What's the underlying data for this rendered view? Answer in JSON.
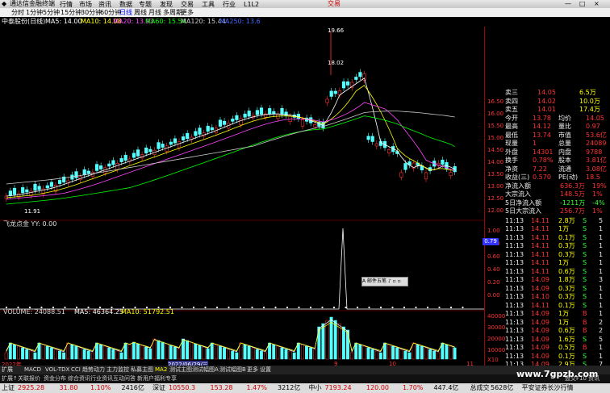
{
  "titlebar": {
    "app_title": "通达信金融终端",
    "right_label": "交易",
    "window_controls": [
      "—",
      "□",
      "×"
    ]
  },
  "menu": [
    "行情",
    "市场",
    "资讯",
    "数据",
    "专题",
    "发现",
    "交易",
    "工具",
    "行业",
    "L1L2"
  ],
  "periods": {
    "items": [
      "分时",
      "1分钟",
      "5分钟",
      "15分钟",
      "30分钟",
      "60分钟",
      "日线",
      "周线",
      "月线",
      "多周期",
      "更多"
    ],
    "active": "日线"
  },
  "infobar": {
    "stock": "中泰股份(日线)",
    "ma": [
      {
        "label": "MA5: 14.00",
        "color": "#ffffff"
      },
      {
        "label": "MA10: 14.08",
        "color": "#ffff00"
      },
      {
        "label": "MA20: 13.93",
        "color": "#ff44ff"
      },
      {
        "label": "MA60: 15.54",
        "color": "#00ff00"
      },
      {
        "label": "MA120: 15.44",
        "color": "#cccccc"
      },
      {
        "label": "MA250: 13.6",
        "color": "#4466ff"
      }
    ]
  },
  "price_axis": [
    "16.50",
    "16.00",
    "15.50",
    "15.00",
    "14.50",
    "14.00",
    "13.50",
    "13.00",
    "12.50",
    "12.00"
  ],
  "price_markers": {
    "high": "19.66",
    "mid": "18.02",
    "low": "11.91"
  },
  "indicator_panel": {
    "title": "飞龙点金  YY: 0.00",
    "axis": [
      "1.00",
      "0.80",
      "0.60",
      "0.40",
      "0.20",
      "0.00"
    ],
    "current": "0.79"
  },
  "volume_panel": {
    "title": "VOLUME: 24088.51",
    "ma5": "MA5: 46364.25",
    "ma10": "MA10: 51792.51",
    "axis": [
      "40000",
      "30000",
      "20000",
      "10000"
    ],
    "unit": "X10"
  },
  "date_labels": [
    "2022年",
    "2022/06/29/三",
    "9",
    "10",
    "11"
  ],
  "popup": {
    "label": "A 邮件五笔",
    "extra": "♪ ▫ ▫"
  },
  "quote": {
    "asks": [
      {
        "name": "卖三",
        "price": "14.05",
        "vol": "6.5万"
      },
      {
        "name": "卖四",
        "price": "14.02",
        "vol": "10.0万"
      },
      {
        "name": "卖五",
        "price": "14.01",
        "vol": "17.4万"
      }
    ],
    "stats": [
      [
        "今开",
        "13.78",
        "均价",
        "14.05"
      ],
      [
        "最高",
        "14.12",
        "量比",
        "0.97"
      ],
      [
        "最低",
        "13.74",
        "市值",
        "53.6亿"
      ],
      [
        "现量",
        "1",
        "总量",
        "24089"
      ],
      [
        "外盘",
        "14301",
        "内盘",
        "9788"
      ],
      [
        "换手",
        "0.78%",
        "股本",
        "3.81亿"
      ],
      [
        "净资",
        "7.22",
        "流通",
        "3.08亿"
      ],
      [
        "收益(三)",
        "0.570",
        "PE(动)",
        "18.5"
      ]
    ],
    "flows": [
      [
        "净流入额",
        "636.3万",
        "19%"
      ],
      [
        "大宗流入",
        "148.5万",
        "1%"
      ],
      [
        "5日净流入额",
        "-1211万",
        "-4%"
      ],
      [
        "5日大宗流入",
        "256.7万",
        "1%"
      ]
    ],
    "ticks": [
      [
        "11:13",
        "14.11",
        "2.8万",
        "S",
        "5"
      ],
      [
        "11:13",
        "14.11",
        "1万",
        "S",
        "1"
      ],
      [
        "11:13",
        "14.11",
        "0.1万",
        "S",
        "1"
      ],
      [
        "11:13",
        "14.11",
        "0.3万",
        "S",
        "1"
      ],
      [
        "11:13",
        "14.11",
        "0.3万",
        "S",
        "1"
      ],
      [
        "11:13",
        "14.11",
        "1万",
        "S",
        "1"
      ],
      [
        "11:13",
        "14.11",
        "0.6万",
        "S",
        "1"
      ],
      [
        "11:13",
        "14.09",
        "1.8万",
        "S",
        "3"
      ],
      [
        "11:13",
        "14.09",
        "0.3万",
        "S",
        "1"
      ],
      [
        "11:13",
        "14.10",
        "0.3万",
        "S",
        "1"
      ],
      [
        "11:13",
        "14.11",
        "0.1万",
        "S",
        "1"
      ],
      [
        "11:13",
        "14.09",
        "1万",
        "B",
        "1"
      ],
      [
        "11:13",
        "14.09",
        "1万",
        "B",
        "2"
      ],
      [
        "11:13",
        "14.09",
        "0.6万",
        "B",
        "2"
      ],
      [
        "11:13",
        "14.09",
        "1.6万",
        "S",
        "5"
      ],
      [
        "11:13",
        "14.09",
        "0.5万",
        "B",
        "1"
      ],
      [
        "11:13",
        "14.09",
        "0.1万",
        "S",
        "1"
      ],
      [
        "11:13",
        "14.09",
        "2.9万",
        "S",
        "7"
      ],
      [
        "11:13",
        "14.11",
        "0.5万",
        "B",
        "1"
      ]
    ]
  },
  "bottom_tabs": {
    "items": [
      "扩展",
      "MACD",
      "VOL-TDX",
      "CCI",
      "趋势动力",
      "主力监控",
      "私募主图",
      "MA2",
      "测试主图",
      "测试幅图A",
      "测试幅图B",
      "更多",
      "设置"
    ],
    "active": "MA2"
  },
  "func_bar": [
    "扩展↑",
    "关联报价",
    "资金分布",
    "综合资讯",
    "行业资讯",
    "互动问答",
    "新用户福利专享"
  ],
  "func_right": "盘交F10 资讯",
  "status": [
    {
      "label": "上证",
      "color": "#000000"
    },
    {
      "label": "2925.28",
      "color": "#cc0000"
    },
    {
      "label": "31.80",
      "color": "#cc0000"
    },
    {
      "label": "1.10%",
      "color": "#cc0000"
    },
    {
      "label": "2416亿",
      "color": "#000000"
    },
    {
      "label": "深证",
      "color": "#000000"
    },
    {
      "label": "10550.3",
      "color": "#cc0000"
    },
    {
      "label": "153.28",
      "color": "#cc0000"
    },
    {
      "label": "1.47%",
      "color": "#cc0000"
    },
    {
      "label": "3212亿",
      "color": "#000000"
    },
    {
      "label": "中小",
      "color": "#000000"
    },
    {
      "label": "7193.24",
      "color": "#cc0000"
    },
    {
      "label": "120.00",
      "color": "#cc0000"
    },
    {
      "label": "1.70%",
      "color": "#cc0000"
    },
    {
      "label": "447.4亿",
      "color": "#000000"
    },
    {
      "label": "总成交",
      "color": "#000000"
    },
    {
      "label": "5628亿",
      "color": "#000000"
    },
    {
      "label": "平安证券长沙行情",
      "color": "#000000"
    }
  ],
  "watermark": "www.7gpzb.com",
  "colors": {
    "up": "#ff3333",
    "down": "#33ffff",
    "accent": "#ffff00"
  }
}
